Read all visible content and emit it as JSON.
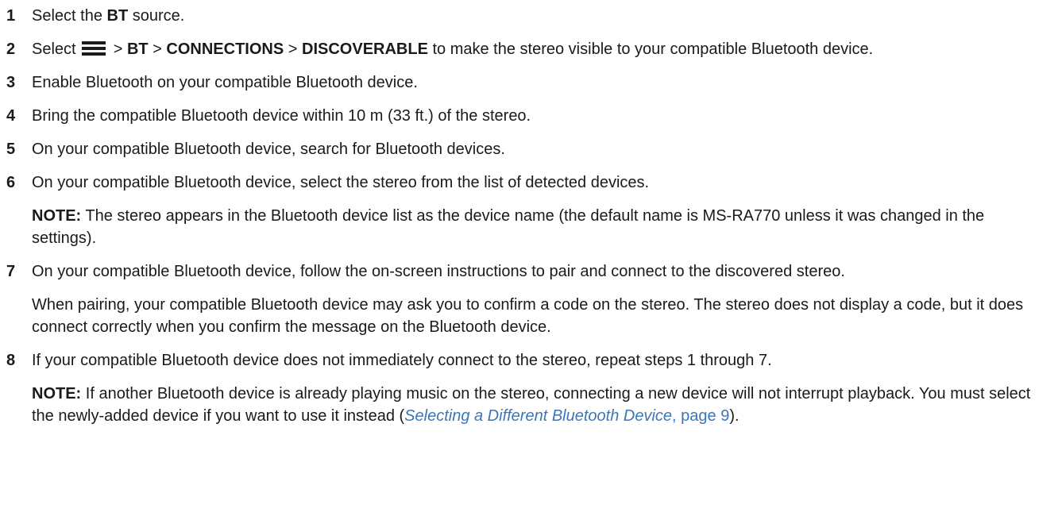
{
  "steps": [
    {
      "number": "1",
      "pre": "Select the ",
      "b1": "BT",
      "post": " source."
    },
    {
      "number": "2",
      "pre": "Select ",
      "sep1": " > ",
      "b1": "BT",
      "sep2": " > ",
      "b2": "CONNECTIONS",
      "sep3": " > ",
      "b3": "DISCOVERABLE",
      "post": " to make the stereo visible to your compatible Bluetooth device.",
      "icon": "menu-icon"
    },
    {
      "number": "3",
      "text": "Enable Bluetooth on your compatible Bluetooth device."
    },
    {
      "number": "4",
      "text": "Bring the compatible Bluetooth device within 10 m (33 ft.) of the stereo."
    },
    {
      "number": "5",
      "text": "On your compatible Bluetooth device, search for Bluetooth devices."
    },
    {
      "number": "6",
      "text": "On your compatible Bluetooth device, select the stereo from the list of detected devices.",
      "note_label": "NOTE:",
      "note_text": " The stereo appears in the Bluetooth device list as the device name (the default name is MS-RA770 unless it was changed in the settings)."
    },
    {
      "number": "7",
      "text": "On your compatible Bluetooth device, follow the on-screen instructions to pair and connect to the discovered stereo.",
      "extra": "When pairing, your compatible Bluetooth device may ask you to confirm a code on the stereo. The stereo does not display a code, but it does connect correctly when you confirm the message on the Bluetooth device."
    },
    {
      "number": "8",
      "text": "If your compatible Bluetooth device does not immediately connect to the stereo, repeat steps 1 through 7.",
      "note_label": "NOTE:",
      "note_text": " If another Bluetooth device is already playing music on the stereo, connecting a new device will not interrupt playback. You must select the newly-added device if you want to use it instead (",
      "link_text": "Selecting a Different Bluetooth Device",
      "link_page": ", page 9",
      "note_end": ")."
    }
  ],
  "colors": {
    "text": "#1a1a1a",
    "link": "#3c76b8"
  }
}
